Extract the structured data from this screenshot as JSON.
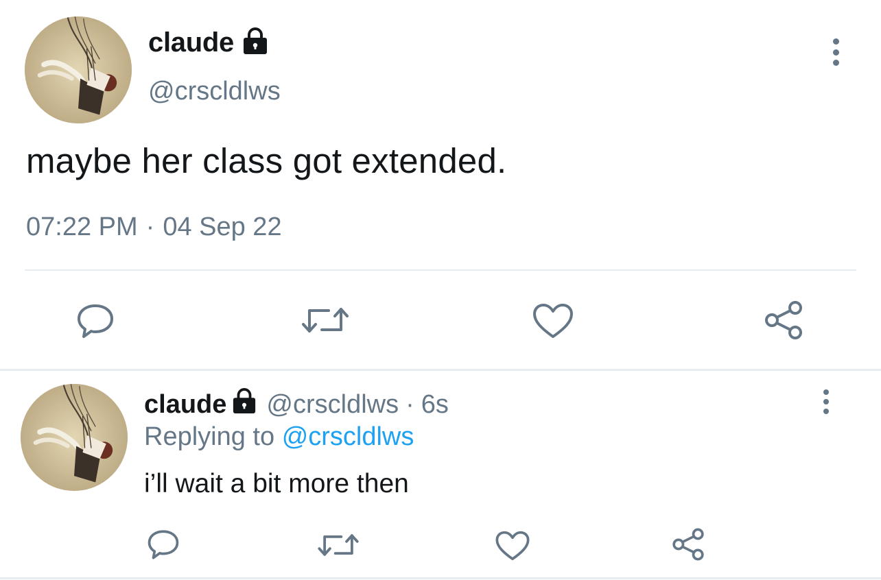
{
  "main_tweet": {
    "author_name": "claude",
    "author_handle": "@crscldlws",
    "text": "maybe her class got extended.",
    "time": "07:22 PM",
    "separator": "·",
    "date": "04 Sep 22",
    "locked": true
  },
  "reply_tweet": {
    "author_name": "claude",
    "author_handle": "@crscldlws",
    "separator": "·",
    "age": "6s",
    "replying_prefix": "Replying to",
    "replying_to": "@crscldlws",
    "text": "i’ll wait a bit more then",
    "locked": true
  },
  "actions": [
    "reply-icon",
    "retweet-icon",
    "like-icon",
    "share-icon"
  ],
  "colors": {
    "text_primary": "#14171a",
    "text_secondary": "#657786",
    "link": "#1da1f2",
    "divider": "#e6ecf0"
  }
}
